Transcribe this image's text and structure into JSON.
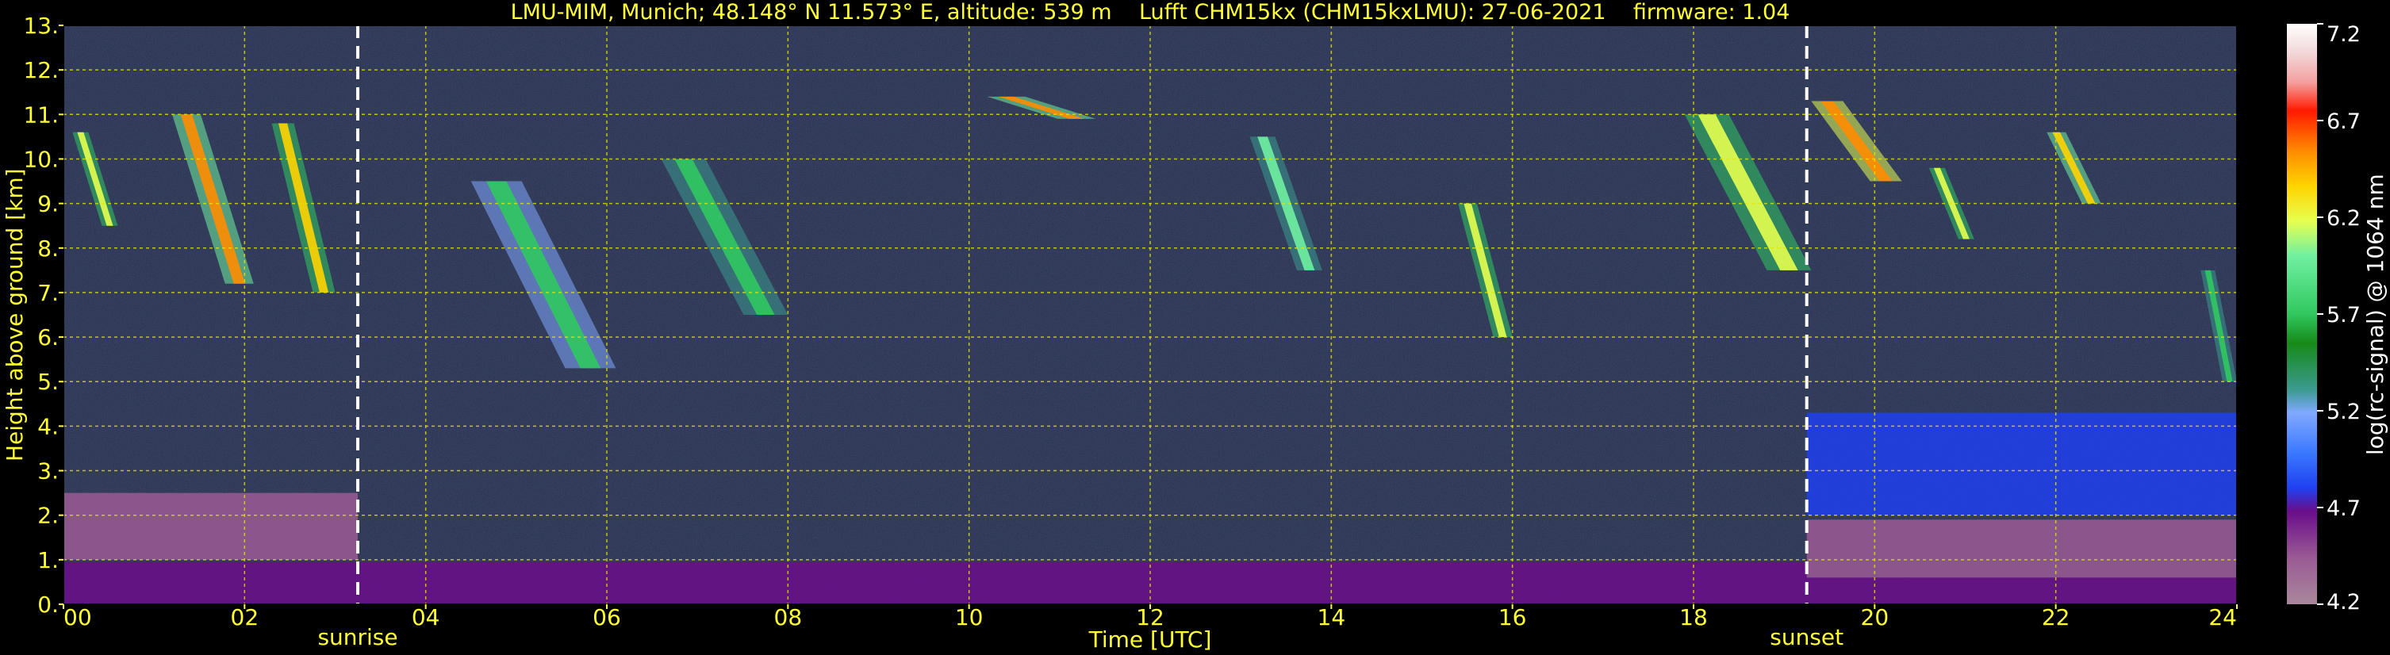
{
  "header": {
    "title": "LMU-MIM, Munich; 48.148° N 11.573° E, altitude: 539 m    Lufft CHM15kx (CHM15kxLMU): 27-06-2021    firmware: 1.04"
  },
  "chart_data": {
    "type": "heatmap",
    "xlabel": "Time [UTC]",
    "ylabel": "Height above ground [km]",
    "x_ticks": [
      "00",
      "02",
      "04",
      "06",
      "08",
      "10",
      "12",
      "14",
      "16",
      "18",
      "20",
      "22",
      "24"
    ],
    "x_tick_values": [
      0,
      2,
      4,
      6,
      8,
      10,
      12,
      14,
      16,
      18,
      20,
      22,
      24
    ],
    "y_ticks": [
      "0.",
      "1.",
      "2.",
      "3.",
      "4.",
      "5.",
      "6.",
      "7.",
      "8.",
      "9.",
      "10.",
      "11.",
      "12.",
      "13."
    ],
    "y_tick_values": [
      0,
      1,
      2,
      3,
      4,
      5,
      6,
      7,
      8,
      9,
      10,
      11,
      12,
      13
    ],
    "xlim": [
      0,
      24
    ],
    "ylim": [
      0,
      13
    ],
    "grid": true,
    "markers": [
      {
        "label": "sunrise",
        "time": 3.25
      },
      {
        "label": "sunset",
        "time": 19.25
      }
    ],
    "colorbar": {
      "label": "log(rc-signal) @ 1064 nm",
      "range": [
        4.2,
        7.2
      ],
      "ticks": [
        "7.2",
        "6.7",
        "6.2",
        "5.7",
        "5.2",
        "4.7",
        "4.2"
      ],
      "tick_values": [
        7.2,
        6.7,
        6.2,
        5.7,
        5.2,
        4.7,
        4.2
      ]
    },
    "features": [
      {
        "type": "layer",
        "t0": 0,
        "t1": 19.25,
        "h0": 0,
        "h1": 0.95,
        "level": 4.75
      },
      {
        "type": "layer",
        "t0": 0,
        "t1": 3.25,
        "h0": 1.0,
        "h1": 2.5,
        "level": 4.45
      },
      {
        "type": "layer",
        "t0": 19.25,
        "t1": 24,
        "h0": 0,
        "h1": 0.6,
        "level": 4.7
      },
      {
        "type": "layer",
        "t0": 19.25,
        "t1": 24,
        "h0": 0.6,
        "h1": 1.9,
        "level": 4.55
      },
      {
        "type": "layer",
        "t0": 19.25,
        "t1": 24,
        "h0": 2.0,
        "h1": 4.3,
        "level": 4.85
      },
      {
        "type": "streak",
        "t0": 0.1,
        "t1": 0.6,
        "h0": 8.5,
        "h1": 10.6,
        "level": 6.3
      },
      {
        "type": "streak",
        "t0": 1.2,
        "t1": 2.1,
        "h0": 7.2,
        "h1": 11.0,
        "level": 6.6
      },
      {
        "type": "streak",
        "t0": 2.3,
        "t1": 3.0,
        "h0": 7.0,
        "h1": 10.8,
        "level": 6.4
      },
      {
        "type": "streak",
        "t0": 4.5,
        "t1": 6.1,
        "h0": 5.3,
        "h1": 9.5,
        "level": 5.8
      },
      {
        "type": "streak",
        "t0": 6.6,
        "t1": 8.0,
        "h0": 6.5,
        "h1": 10.0,
        "level": 5.9
      },
      {
        "type": "streak",
        "t0": 10.2,
        "t1": 11.4,
        "h0": 10.9,
        "h1": 11.4,
        "level": 6.6
      },
      {
        "type": "streak",
        "t0": 13.1,
        "t1": 13.9,
        "h0": 7.5,
        "h1": 10.5,
        "level": 6.0
      },
      {
        "type": "streak",
        "t0": 15.4,
        "t1": 16.0,
        "h0": 6.0,
        "h1": 9.0,
        "level": 6.3
      },
      {
        "type": "streak",
        "t0": 17.9,
        "t1": 19.3,
        "h0": 7.5,
        "h1": 11.0,
        "level": 6.2
      },
      {
        "type": "streak",
        "t0": 19.3,
        "t1": 20.3,
        "h0": 9.5,
        "h1": 11.3,
        "level": 6.7
      },
      {
        "type": "streak",
        "t0": 20.6,
        "t1": 21.1,
        "h0": 8.2,
        "h1": 9.8,
        "level": 6.3
      },
      {
        "type": "streak",
        "t0": 21.9,
        "t1": 22.5,
        "h0": 9.0,
        "h1": 10.6,
        "level": 6.5
      },
      {
        "type": "streak",
        "t0": 23.6,
        "t1": 24.0,
        "h0": 5.0,
        "h1": 7.5,
        "level": 5.9
      }
    ]
  }
}
